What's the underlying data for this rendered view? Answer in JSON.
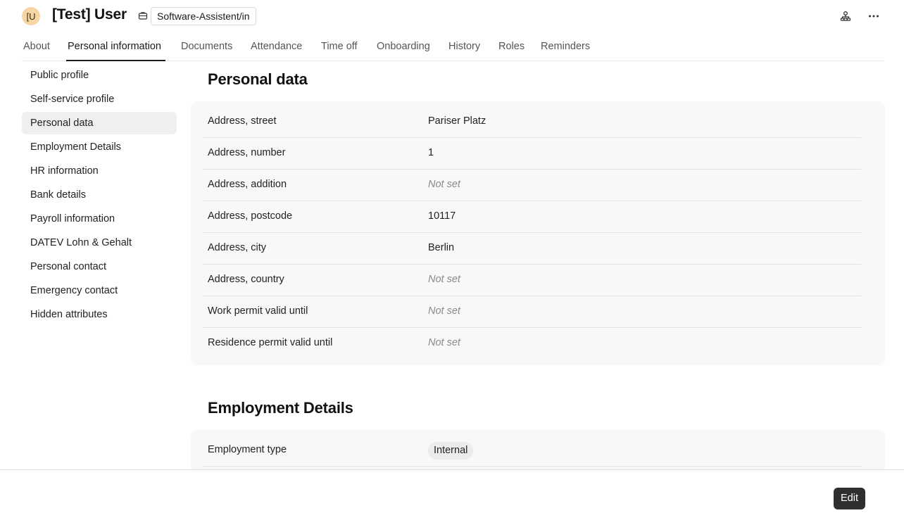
{
  "header": {
    "avatar_initials": "[U",
    "user_name": "[Test] User",
    "position": "Software-Assistent/in",
    "icons": [
      "briefcase-icon",
      "org-chart-icon",
      "more-icon"
    ]
  },
  "tabs": [
    {
      "label": "About"
    },
    {
      "label": "Personal information",
      "active": true
    },
    {
      "label": "Documents"
    },
    {
      "label": "Attendance"
    },
    {
      "label": "Time off"
    },
    {
      "label": "Onboarding"
    },
    {
      "label": "History"
    },
    {
      "label": "Roles"
    },
    {
      "label": "Reminders"
    }
  ],
  "sidebar": {
    "items": [
      {
        "label": "Public profile"
      },
      {
        "label": "Self-service profile"
      },
      {
        "label": "Personal data",
        "active": true
      },
      {
        "label": "Employment Details"
      },
      {
        "label": "HR information"
      },
      {
        "label": "Bank details"
      },
      {
        "label": "Payroll information"
      },
      {
        "label": "DATEV Lohn & Gehalt"
      },
      {
        "label": "Personal contact"
      },
      {
        "label": "Emergency contact"
      },
      {
        "label": "Hidden attributes"
      }
    ]
  },
  "personal_data": {
    "title": "Personal data",
    "rows": [
      {
        "label": "Address, street",
        "value": "Pariser Platz"
      },
      {
        "label": "Address, number",
        "value": "1"
      },
      {
        "label": "Address, addition",
        "value": "Not set",
        "empty": true
      },
      {
        "label": "Address, postcode",
        "value": "10117"
      },
      {
        "label": "Address, city",
        "value": "Berlin"
      },
      {
        "label": "Address, country",
        "value": "Not set",
        "empty": true
      },
      {
        "label": "Work permit valid until",
        "value": "Not set",
        "empty": true
      },
      {
        "label": "Residence permit valid until",
        "value": "Not set",
        "empty": true
      }
    ]
  },
  "employment_details": {
    "title": "Employment Details",
    "rows": [
      {
        "label": "Employment type",
        "value": "Internal"
      }
    ]
  },
  "footer": {
    "edit_label": "Edit"
  }
}
